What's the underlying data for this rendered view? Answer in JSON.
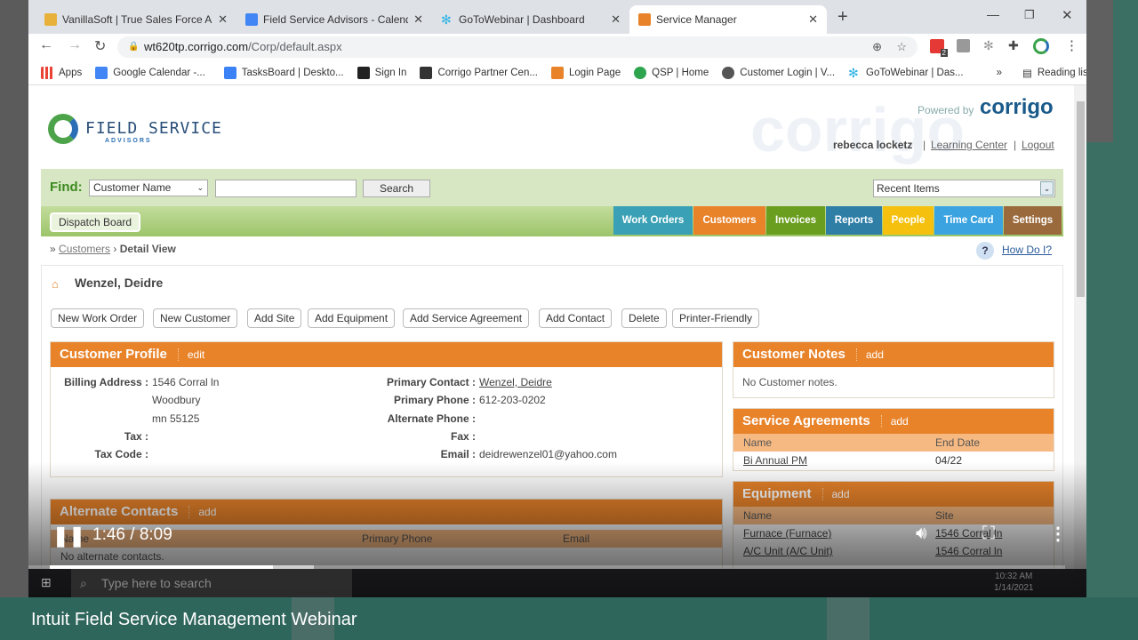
{
  "browser": {
    "tabs": [
      {
        "title": "VanillaSoft | True Sales Force Aut",
        "icon": "vanillasoft-icon",
        "color": "#e8b23a"
      },
      {
        "title": "Field Service Advisors - Calendar",
        "icon": "calendar-icon",
        "color": "#4285f4"
      },
      {
        "title": "GoToWebinar | Dashboard",
        "icon": "gotowebinar-icon",
        "color": "#2bb3e6"
      },
      {
        "title": "Service Manager",
        "icon": "service-manager-icon",
        "color": "#e8832a"
      }
    ],
    "url_host": "wt620tp.corrigo.com",
    "url_path": "/Corp/default.aspx",
    "extension_badge": "2",
    "bookmarks": [
      {
        "label": "Apps",
        "color": "#ea4335"
      },
      {
        "label": "Google Calendar -...",
        "color": "#4285f4"
      },
      {
        "label": "TasksBoard | Deskto...",
        "color": "#3b82f6"
      },
      {
        "label": "Sign In",
        "color": "#222"
      },
      {
        "label": "Corrigo Partner Cen...",
        "color": "#333"
      },
      {
        "label": "Login Page",
        "color": "#e8832a"
      },
      {
        "label": "QSP | Home",
        "color": "#2da44e"
      },
      {
        "label": "Customer Login | V...",
        "color": "#555"
      },
      {
        "label": "GoToWebinar | Das...",
        "color": "#2bb3e6"
      }
    ],
    "more_bookmarks": "»",
    "reading_list": "Reading list"
  },
  "app": {
    "logo_text": "FIELD SERVICE",
    "logo_sub": "ADVISORS",
    "powered_by": "Powered by",
    "brand": "corrigo",
    "user": "rebecca locketz",
    "learning_center": "Learning Center",
    "logout": "Logout",
    "find_label": "Find:",
    "find_select": "Customer Name",
    "find_value": "",
    "search": "Search",
    "recent_items": "Recent Items",
    "dispatch_board": "Dispatch Board",
    "nav": [
      {
        "label": "Work Orders",
        "color": "#3aa0b5"
      },
      {
        "label": "Customers",
        "color": "#e8832a"
      },
      {
        "label": "Invoices",
        "color": "#6a9e1f"
      },
      {
        "label": "Reports",
        "color": "#2e7ea6"
      },
      {
        "label": "People",
        "color": "#f5c10e"
      },
      {
        "label": "Time Card",
        "color": "#3ba3e0"
      },
      {
        "label": "Settings",
        "color": "#9a6a3c"
      }
    ],
    "breadcrumb": {
      "prefix": "»",
      "link": "Customers",
      "sep": "›",
      "current": "Detail View"
    },
    "how_do_i": "How Do I?",
    "customer_name": "Wenzel, Deidre",
    "actions": [
      "New Work Order",
      "New Customer",
      "Add Site",
      "Add Equipment",
      "Add Service Agreement",
      "Add Contact",
      "Delete",
      "Printer-Friendly"
    ],
    "profile": {
      "title": "Customer Profile",
      "edit": "edit",
      "billing_label": "Billing Address :",
      "billing": [
        "1546 Corral ln",
        "Woodbury",
        "mn 55125"
      ],
      "tax_label": "Tax :",
      "tax_code_label": "Tax Code :",
      "primary_contact_label": "Primary Contact :",
      "primary_contact": "Wenzel, Deidre",
      "primary_phone_label": "Primary Phone :",
      "primary_phone": "612-203-0202",
      "alt_phone_label": "Alternate Phone :",
      "fax_label": "Fax :",
      "email_label": "Email :",
      "email": "deidrewenzel01@yahoo.com"
    },
    "notes": {
      "title": "Customer Notes",
      "add": "add",
      "text": "No Customer notes."
    },
    "agreements": {
      "title": "Service Agreements",
      "add": "add",
      "cols": [
        "Name",
        "End Date"
      ],
      "rows": [
        [
          "Bi Annual PM",
          "04/22"
        ]
      ]
    },
    "equipment": {
      "title": "Equipment",
      "add": "add",
      "cols": [
        "Name",
        "Site"
      ],
      "rows": [
        [
          "Furnace (Furnace)",
          "1546 Corral ln"
        ],
        [
          "A/C Unit (A/C Unit)",
          "1546 Corral ln"
        ]
      ]
    },
    "alt_contacts": {
      "title": "Alternate Contacts",
      "add": "add",
      "cols": [
        "Name",
        "Primary Phone",
        "Email"
      ],
      "empty": "No alternate contacts."
    }
  },
  "taskbar": {
    "search_placeholder": "Type here to search",
    "time": "10:32 AM",
    "date": "1/14/2021"
  },
  "video": {
    "time": "1:46 / 8:09",
    "played_fraction": 0.22,
    "buffered_fraction": 0.26,
    "title": "Intuit Field Service Management Webinar"
  }
}
